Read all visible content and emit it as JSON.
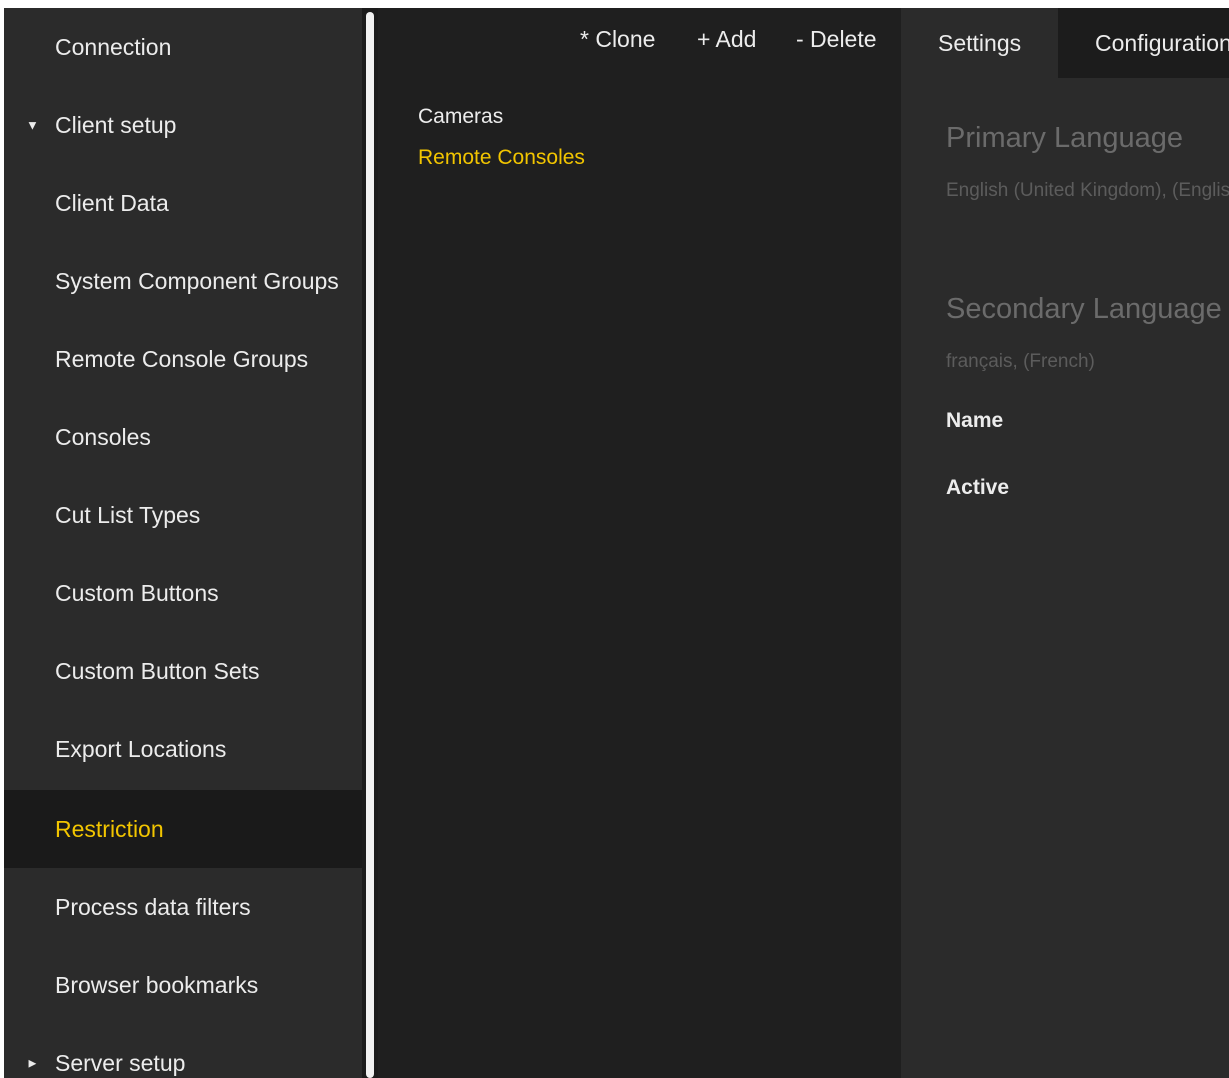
{
  "sidebar": {
    "items": [
      {
        "label": "Connection",
        "caret": ""
      },
      {
        "label": "Client setup",
        "caret": "▼"
      },
      {
        "label": "Client Data",
        "caret": ""
      },
      {
        "label": "System Component Groups",
        "caret": ""
      },
      {
        "label": "Remote Console Groups",
        "caret": ""
      },
      {
        "label": "Consoles",
        "caret": ""
      },
      {
        "label": "Cut List Types",
        "caret": ""
      },
      {
        "label": "Custom Buttons",
        "caret": ""
      },
      {
        "label": "Custom Button Sets",
        "caret": ""
      },
      {
        "label": "Export Locations",
        "caret": ""
      },
      {
        "label": "Restriction",
        "caret": "",
        "selected": true
      },
      {
        "label": "Process data filters",
        "caret": ""
      },
      {
        "label": "Browser bookmarks",
        "caret": ""
      },
      {
        "label": "Server setup",
        "caret": "►"
      }
    ]
  },
  "toolbar": {
    "clone_label": "* Clone",
    "add_label": "+ Add",
    "delete_label": "- Delete"
  },
  "list": {
    "items": [
      {
        "label": "Cameras",
        "active": false
      },
      {
        "label": "Remote Consoles",
        "active": true
      }
    ]
  },
  "tabs": {
    "settings": "Settings",
    "configuration": "Configuration"
  },
  "details": {
    "primary_language_title": "Primary Language",
    "primary_language_value": "English (United Kingdom), (English (United Kingdom))",
    "secondary_language_title": "Secondary Language",
    "secondary_language_value": "français, (French)",
    "name_label": "Name",
    "active_label": "Active"
  },
  "colors": {
    "accent": "#f2c500",
    "sidebar_bg": "#2b2b2b",
    "panel_bg": "#1f1f1f",
    "text": "#ececec",
    "muted_text": "#6b6b6b"
  }
}
